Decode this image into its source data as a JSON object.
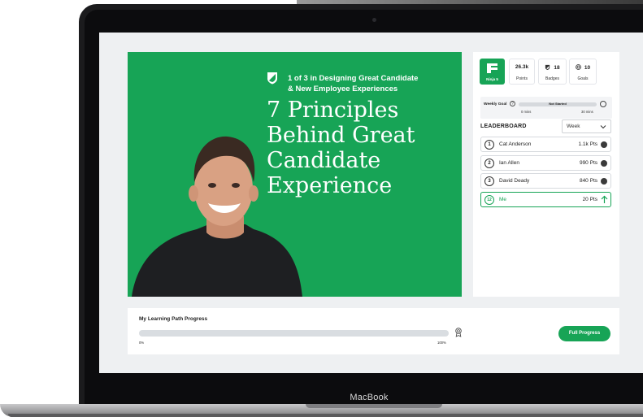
{
  "device": {
    "label": "MacBook"
  },
  "hero": {
    "series": [
      "1 of 3 in Designing Great Candidate",
      "& New Employee Experiences"
    ],
    "title": [
      "7 Principles",
      "Behind Great",
      "Candidate",
      "Experience"
    ]
  },
  "stats": {
    "ninja": {
      "label": "Ninja 5"
    },
    "points": {
      "value": "26.3k",
      "label": "Points"
    },
    "badges": {
      "value": "18",
      "label": "Badges"
    },
    "goals": {
      "value": "10",
      "label": "Goals"
    }
  },
  "weekly_goal": {
    "label": "Weekly Goal",
    "status": "Not Started",
    "min": "0 mins",
    "max": "30 mins",
    "progress_fraction": 0
  },
  "leaderboard": {
    "title": "LEADERBOARD",
    "period": "Week",
    "rows": [
      {
        "rank": "1",
        "name": "Cat Anderson",
        "points": "1.1k Pts"
      },
      {
        "rank": "2",
        "name": "Ian Allen",
        "points": "990 Pts"
      },
      {
        "rank": "3",
        "name": "David Deady",
        "points": "840 Pts"
      },
      {
        "rank": "12",
        "name": "Me",
        "points": "20 Pts"
      }
    ]
  },
  "learning_path": {
    "title": "My Learning Path Progress",
    "min_label": "0%",
    "max_label": "100%",
    "progress_fraction": 0,
    "button": "Full Progress"
  },
  "colors": {
    "brand": "#17a456",
    "background": "#eef0f2"
  }
}
